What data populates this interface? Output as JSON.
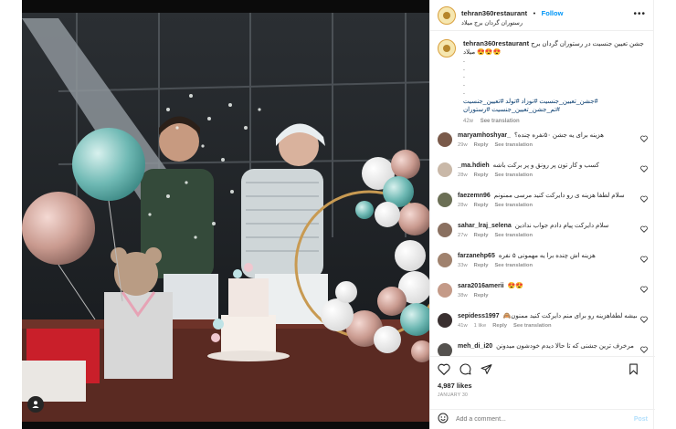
{
  "header": {
    "username": "tehran360restaurant",
    "separator": "•",
    "follow_label": "Follow",
    "location": "رستوران گردان برج میلاد",
    "more_icon": "more-icon"
  },
  "caption": {
    "username": "tehran360restaurant",
    "text": "جشن تعیین جنسیت در رستوران گردان برج میلاد 😍😍😍",
    "dots": ".\n.\n.\n.\n.",
    "hashtags": "#جشن_تعیین_جنسیت #نوزاد #تولد #تعیین_جنسیت #تم_جشن_تعیین_جنسیت #رستوران",
    "time": "42w",
    "see_translation": "See translation"
  },
  "comments": [
    {
      "user": "maryamhoshyar_",
      "text": "هزینه برای یه جشن ۵۰نفره چنده؟",
      "time": "29w",
      "reply": "Reply",
      "translate": "See translation",
      "avatar_color": "#7a5a4a"
    },
    {
      "user": "_ma.hdieh",
      "text": "کسب و کار تون پر رونق و پر برکت باشه",
      "time": "28w",
      "reply": "Reply",
      "translate": "See translation",
      "avatar_color": "#c9b8a8"
    },
    {
      "user": "faezemn96",
      "text": "سلام لطفا هزینه ی رو دایرکت کنید مرسی ممنونم",
      "time": "28w",
      "reply": "Reply",
      "translate": "See translation",
      "avatar_color": "#6b6f55"
    },
    {
      "user": "sahar_lraj_selena",
      "text": "سلام دایرکت پیام دادم جواب ندادین",
      "time": "27w",
      "reply": "Reply",
      "translate": "See translation",
      "avatar_color": "#8a7060"
    },
    {
      "user": "farzanehp65",
      "text": "هزینه اش چنده برا یه مهمونی ۵ نفره",
      "time": "33w",
      "reply": "Reply",
      "translate": "See translation",
      "avatar_color": "#a0826e"
    },
    {
      "user": "sara2016amerii",
      "text": "😍😍",
      "time": "38w",
      "reply": "Reply",
      "translate": "",
      "avatar_color": "#c49a88"
    },
    {
      "user": "sepidess1997",
      "text": "میشه لطفاهزینه رو برای منم دایرکت کنید ممنون🙈",
      "time": "41w",
      "likes": "1 like",
      "reply": "Reply",
      "translate": "See translation",
      "avatar_color": "#3a3030"
    },
    {
      "user": "meh_di_i20",
      "text": "مرخرف ترین جشنی که تا حالا دیدم خودشون میدونن",
      "time": "",
      "reply": "",
      "translate": "",
      "avatar_color": "#55524f"
    }
  ],
  "actions": {
    "likes": "4,987 likes",
    "date": "JANUARY 30",
    "add_comment_placeholder": "Add a comment...",
    "post_label": "Post"
  },
  "colors": {
    "accent": "#0095f6",
    "post_disabled": "#b2dffc",
    "hashtag": "#00376b",
    "muted": "#8e8e8e"
  }
}
